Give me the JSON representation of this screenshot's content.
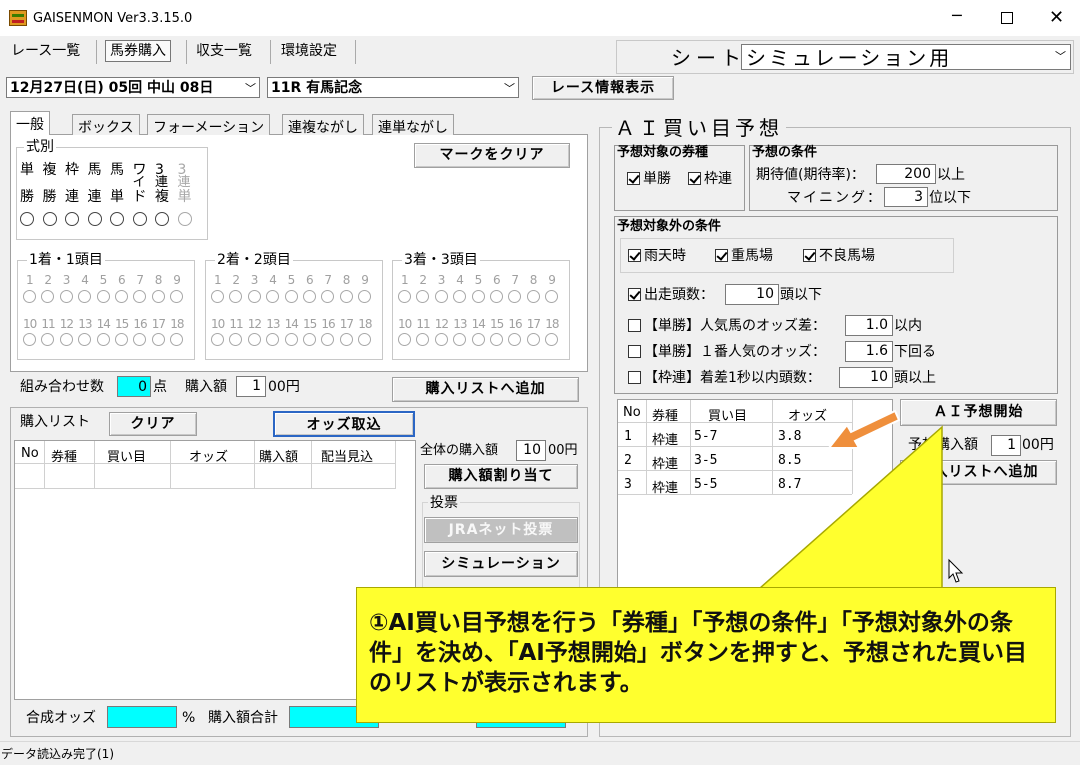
{
  "window": {
    "title": "GAISENMON Ver3.3.15.0"
  },
  "menu": [
    "レース一覧",
    "馬券購入",
    "収支一覧",
    "環境設定"
  ],
  "sheet": {
    "label": "シート",
    "value": "シミュレーション用"
  },
  "race": {
    "date": "12月27日(日) 05回 中山 08日",
    "name": "11R 有馬記念",
    "info_button": "レース情報表示"
  },
  "tabs": [
    "一般",
    "ボックス",
    "フォーメーション",
    "連複ながし",
    "連単ながし"
  ],
  "shiki": {
    "label": "式別",
    "types": [
      {
        "top": "単",
        "bottom": "勝",
        "dim": false
      },
      {
        "top": "複",
        "bottom": "勝",
        "dim": false
      },
      {
        "top": "枠",
        "bottom": "連",
        "dim": false
      },
      {
        "top": "馬",
        "bottom": "連",
        "dim": false
      },
      {
        "top": "馬",
        "bottom": "単",
        "dim": false
      },
      {
        "top": "ワ",
        "mid": "イ",
        "bottom": "ド",
        "dim": false
      },
      {
        "top": "3",
        "mid": "連",
        "bottom": "複",
        "dim": false
      },
      {
        "top": "3",
        "mid": "連",
        "bottom": "単",
        "dim": true
      }
    ]
  },
  "clear_mark_button": "マークをクリア",
  "positions": [
    {
      "label": "1着・1頭目"
    },
    {
      "label": "2着・2頭目"
    },
    {
      "label": "3着・3頭目"
    }
  ],
  "numbers_row1": [
    "1",
    "2",
    "3",
    "4",
    "5",
    "6",
    "7",
    "8",
    "9"
  ],
  "numbers_row2": [
    "10",
    "11",
    "12",
    "13",
    "14",
    "15",
    "16",
    "17",
    "18"
  ],
  "combo": {
    "label": "組み合わせ数",
    "value": "0",
    "unit": "点",
    "amount_label": "購入額",
    "amount_value": "1",
    "amount_unit": "00円",
    "add_button": "購入リストへ追加"
  },
  "purchase_list": {
    "label": "購入リスト",
    "clear_button": "クリア",
    "odds_button": "オッズ取込",
    "columns": [
      "No",
      "券種",
      "買い目",
      "オッズ",
      "購入額",
      "配当見込"
    ]
  },
  "total": {
    "label": "全体の購入額",
    "value": "10",
    "unit": "00円",
    "allocate_button": "購入額割り当て"
  },
  "vote": {
    "label": "投票",
    "jra_button": "JRAネット投票",
    "sim_button": "シミュレーション"
  },
  "footer": {
    "odds_label": "合成オッズ",
    "odds_unit": "%",
    "total_label": "購入額合計"
  },
  "ai": {
    "title": "ＡＩ買い目予想",
    "ticket_types": {
      "label": "予想対象の券種",
      "items": [
        {
          "label": "単勝",
          "checked": true
        },
        {
          "label": "枠連",
          "checked": true
        }
      ]
    },
    "conditions": {
      "label": "予想の条件",
      "expected_label": "期待値(期待率)：",
      "expected_value": "200",
      "expected_unit": "以上",
      "mining_label": "マイニング：",
      "mining_value": "3",
      "mining_unit": "位以下"
    },
    "exclusions": {
      "label": "予想対象外の条件",
      "weather": [
        {
          "label": "雨天時",
          "checked": true
        },
        {
          "label": "重馬場",
          "checked": true
        },
        {
          "label": "不良馬場",
          "checked": true
        }
      ],
      "runners": {
        "label": "出走頭数：",
        "value": "10",
        "unit": "頭以下",
        "checked": true
      },
      "rules": [
        {
          "label": "【単勝】人気馬のオッズ差：",
          "value": "1.0",
          "unit": "以内",
          "checked": false
        },
        {
          "label": "【単勝】１番人気のオッズ：",
          "value": "1.6",
          "unit": "下回る",
          "checked": false
        },
        {
          "label": "【枠連】着差1秒以内頭数：",
          "value": "10",
          "unit": "頭以上",
          "checked": false
        }
      ]
    },
    "results": {
      "columns": [
        "No",
        "券種",
        "買い目",
        "オッズ"
      ],
      "rows": [
        {
          "no": "1",
          "type": "枠連",
          "bet": "5-7",
          "odds": "3.8"
        },
        {
          "no": "2",
          "type": "枠連",
          "bet": "3-5",
          "odds": "8.5"
        },
        {
          "no": "3",
          "type": "枠連",
          "bet": "5-5",
          "odds": "8.7"
        }
      ]
    },
    "start_button": "ＡＩ予想開始",
    "amount_label": "予想購入額",
    "amount_value": "1",
    "amount_unit": "00円",
    "add_button": "購入リストへ追加"
  },
  "callout": {
    "text": "①AI買い目予想を行う「券種」「予想の条件」「予想対象外の条件」を決め、「AI予想開始」ボタンを押すと、予想された買い目のリストが表示されます。"
  },
  "status": "データ読込み完了(1)",
  "colors": {
    "cyan": "#00ffff",
    "callout_fill": "#ffff2e",
    "callout_border": "#a8a800",
    "arrow": "#ef8f3c"
  }
}
